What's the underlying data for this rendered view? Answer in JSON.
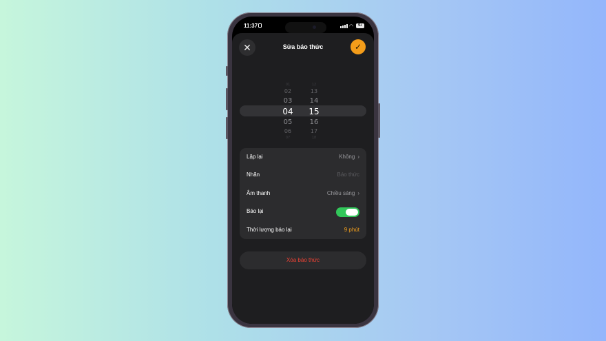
{
  "status": {
    "time": "11:37",
    "battery": "9+"
  },
  "header": {
    "title": "Sửa báo thức",
    "close_icon": "close-icon",
    "confirm_icon": "checkmark-icon"
  },
  "picker": {
    "hours": [
      "01",
      "02",
      "03",
      "04",
      "05",
      "06",
      "07"
    ],
    "minutes": [
      "12",
      "13",
      "14",
      "15",
      "16",
      "17",
      "18"
    ],
    "selected_hour": "04",
    "selected_minute": "15"
  },
  "settings": {
    "repeat": {
      "label": "Lặp lại",
      "value": "Không"
    },
    "name": {
      "label": "Nhãn",
      "placeholder": "Báo thức"
    },
    "sound": {
      "label": "Âm thanh",
      "value": "Chiều sáng"
    },
    "snooze": {
      "label": "Báo lại",
      "enabled": true
    },
    "snooze_duration": {
      "label": "Thời lượng báo lại",
      "value": "9 phút"
    }
  },
  "delete_label": "Xóa báo thức",
  "colors": {
    "accent": "#f49d1a",
    "toggle_on": "#32c75a",
    "danger": "#ef4335"
  }
}
